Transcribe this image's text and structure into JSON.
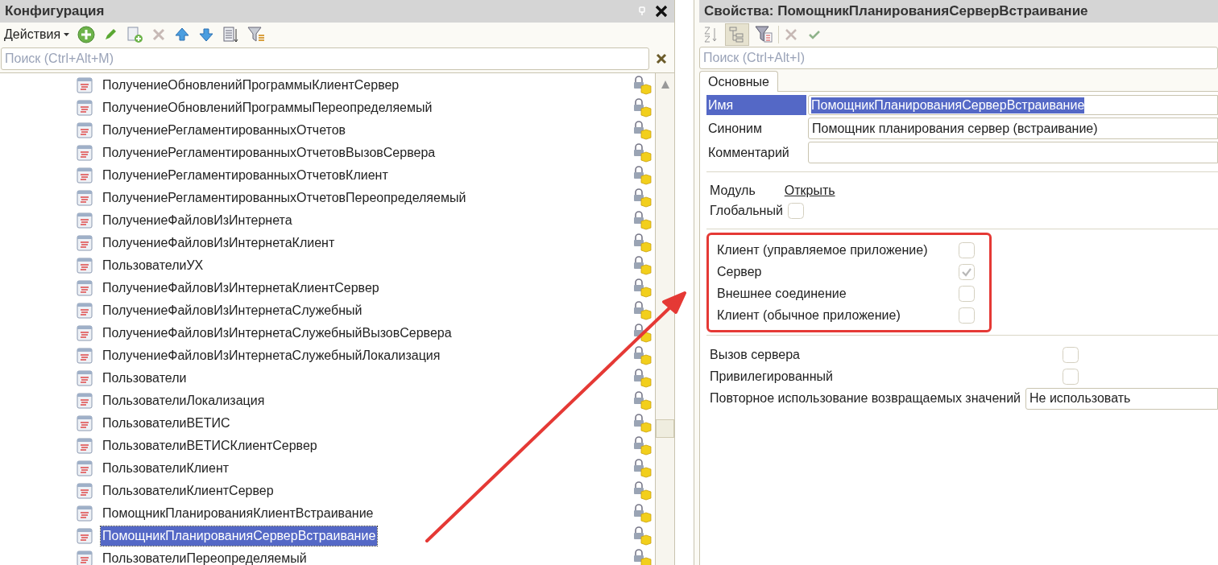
{
  "config_panel": {
    "title": "Конфигурация",
    "actions_label": "Действия",
    "search": {
      "placeholder": "Поиск (Ctrl+Alt+M)"
    },
    "items": [
      {
        "label": "ПолучениеОбновленийПрограммыКлиентСервер",
        "selected": false
      },
      {
        "label": "ПолучениеОбновленийПрограммыПереопределяемый",
        "selected": false
      },
      {
        "label": "ПолучениеРегламентированныхОтчетов",
        "selected": false
      },
      {
        "label": "ПолучениеРегламентированныхОтчетовВызовСервера",
        "selected": false
      },
      {
        "label": "ПолучениеРегламентированныхОтчетовКлиент",
        "selected": false
      },
      {
        "label": "ПолучениеРегламентированныхОтчетовПереопределяемый",
        "selected": false
      },
      {
        "label": "ПолучениеФайловИзИнтернета",
        "selected": false
      },
      {
        "label": "ПолучениеФайловИзИнтернетаКлиент",
        "selected": false
      },
      {
        "label": "ПользователиУХ",
        "selected": false
      },
      {
        "label": "ПолучениеФайловИзИнтернетаКлиентСервер",
        "selected": false
      },
      {
        "label": "ПолучениеФайловИзИнтернетаСлужебный",
        "selected": false
      },
      {
        "label": "ПолучениеФайловИзИнтернетаСлужебныйВызовСервера",
        "selected": false
      },
      {
        "label": "ПолучениеФайловИзИнтернетаСлужебныйЛокализация",
        "selected": false
      },
      {
        "label": "Пользователи",
        "selected": false
      },
      {
        "label": "ПользователиЛокализация",
        "selected": false
      },
      {
        "label": "ПользователиВЕТИС",
        "selected": false
      },
      {
        "label": "ПользователиВЕТИСКлиентСервер",
        "selected": false
      },
      {
        "label": "ПользователиКлиент",
        "selected": false
      },
      {
        "label": "ПользователиКлиентСервер",
        "selected": false
      },
      {
        "label": "ПомощникПланированияКлиентВстраивание",
        "selected": false
      },
      {
        "label": "ПомощникПланированияСерверВстраивание",
        "selected": true
      },
      {
        "label": "ПользователиПереопределяемый",
        "selected": false
      }
    ]
  },
  "properties_panel": {
    "title": "Свойства: ПомощникПланированияСерверВстраивание",
    "tree_view_pressed": true,
    "search": {
      "placeholder": "Поиск (Ctrl+Alt+I)"
    },
    "tabs": [
      {
        "label": "Основные",
        "selected": true
      }
    ],
    "name": {
      "label": "Имя",
      "value": "ПомощникПланированияСерверВстраивание",
      "selected": true
    },
    "synonym": {
      "label": "Синоним",
      "value": "Помощник планирования сервер (встраивание)"
    },
    "comment": {
      "label": "Комментарий"
    },
    "module": {
      "label": "Модуль",
      "link": "Открыть"
    },
    "global": {
      "label": "Глобальный",
      "checked": false
    },
    "contexts": [
      {
        "label": "Клиент (управляемое приложение)",
        "checked": false
      },
      {
        "label": "Сервер",
        "checked": true
      },
      {
        "label": "Внешнее соединение",
        "checked": false
      },
      {
        "label": "Клиент (обычное приложение)",
        "checked": false
      }
    ],
    "flags": [
      {
        "label": "Вызов сервера",
        "checked": false
      },
      {
        "label": "Привилегированный",
        "checked": false
      }
    ],
    "reuse": {
      "label": "Повторное использование возвращаемых значений",
      "value": "Не использовать"
    }
  }
}
